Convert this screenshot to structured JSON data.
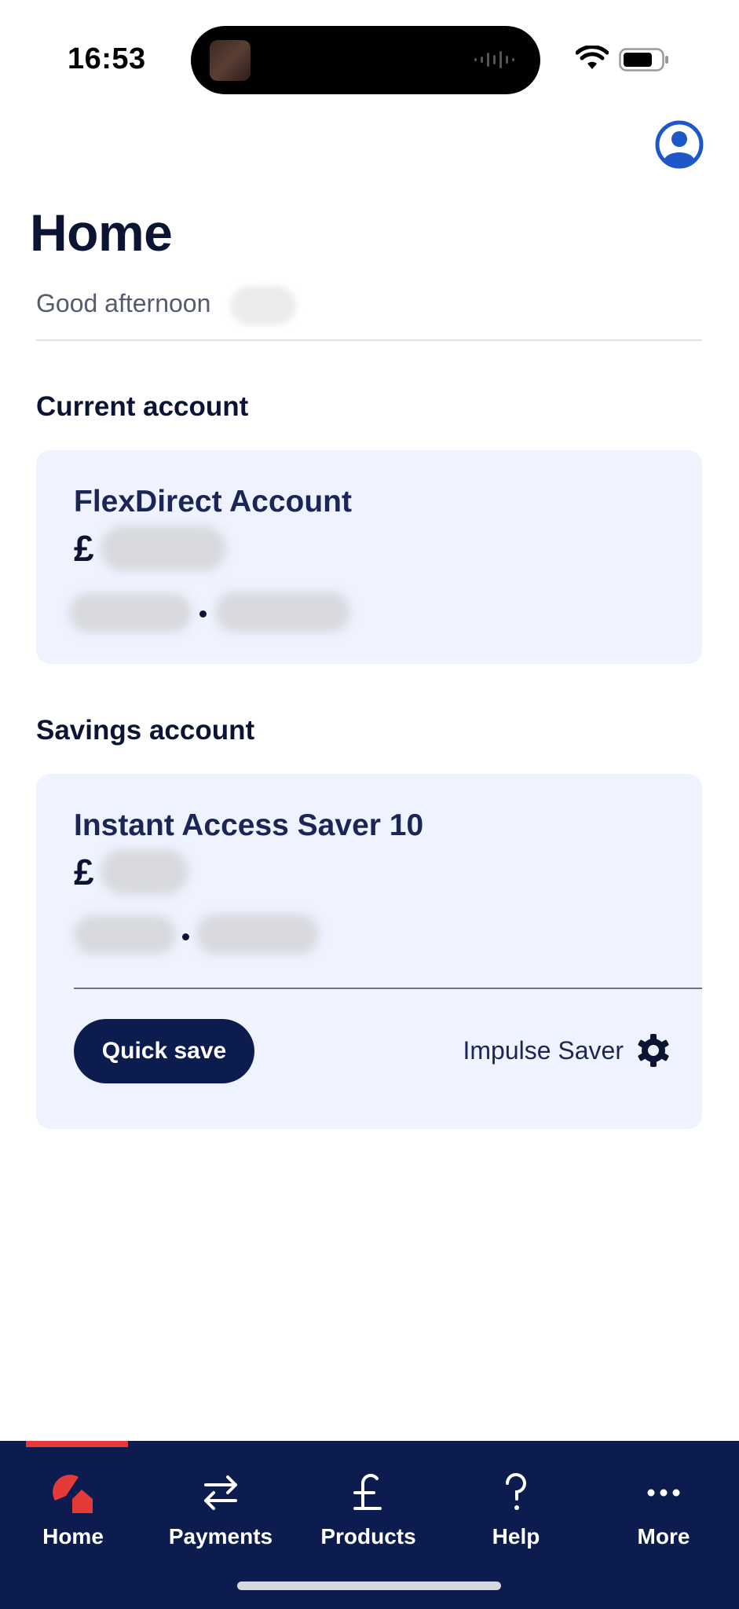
{
  "status_bar": {
    "time": "16:53"
  },
  "header": {
    "title": "Home",
    "greeting": "Good afternoon"
  },
  "current_account": {
    "section_title": "Current account",
    "card": {
      "name": "FlexDirect Account",
      "currency_symbol": "£"
    }
  },
  "savings_account": {
    "section_title": "Savings account",
    "card": {
      "name": "Instant Access Saver 10",
      "currency_symbol": "£",
      "quick_save_label": "Quick save",
      "impulse_saver_label": "Impulse Saver"
    }
  },
  "tabbar": {
    "tabs": [
      {
        "label": "Home",
        "icon": "home-icon",
        "active": true
      },
      {
        "label": "Payments",
        "icon": "transfer-arrows-icon"
      },
      {
        "label": "Products",
        "icon": "pound-icon"
      },
      {
        "label": "Help",
        "icon": "question-icon"
      },
      {
        "label": "More",
        "icon": "more-dots-icon"
      }
    ]
  },
  "colors": {
    "brand_navy": "#0d1c4f",
    "card_background": "#eef3ff",
    "accent_red": "#e43a3a",
    "profile_blue": "#1f57c8"
  }
}
